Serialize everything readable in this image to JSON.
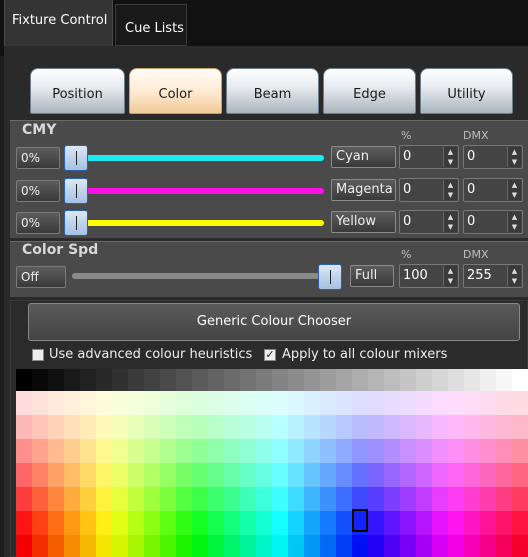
{
  "top_tabs": [
    {
      "label": "Fixture Control"
    },
    {
      "label": "Cue Lists"
    }
  ],
  "feature_tabs": [
    {
      "label": "Position"
    },
    {
      "label": "Color"
    },
    {
      "label": "Beam"
    },
    {
      "label": "Edge"
    },
    {
      "label": "Utility"
    }
  ],
  "active_feature_tab": "Color",
  "cmy": {
    "title": "CMY",
    "pct_header": "%",
    "dmx_header": "DMX",
    "rows": [
      {
        "min_label": "0%",
        "name": "Cyan",
        "percent": "0",
        "dmx": "0",
        "color": "#1ee8f0",
        "level": 0
      },
      {
        "min_label": "0%",
        "name": "Magenta",
        "percent": "0",
        "dmx": "0",
        "color": "#ff10e8",
        "level": 0
      },
      {
        "min_label": "0%",
        "name": "Yellow",
        "percent": "0",
        "dmx": "0",
        "color": "#ffff00",
        "level": 0
      }
    ]
  },
  "color_spd": {
    "title": "Color Spd",
    "pct_header": "%",
    "dmx_header": "DMX",
    "min_label": "Off",
    "max_label": "Full",
    "percent": "100",
    "dmx": "255",
    "level": 1.0
  },
  "chooser": {
    "button_label": "Generic Colour Chooser",
    "opt1_label": "Use advanced colour heuristics",
    "opt1_checked": false,
    "opt2_label": "Apply to all colour mixers",
    "opt2_checked": true
  },
  "colors": {
    "accent": "#2a62b0",
    "panel": "#4a4a4a"
  }
}
